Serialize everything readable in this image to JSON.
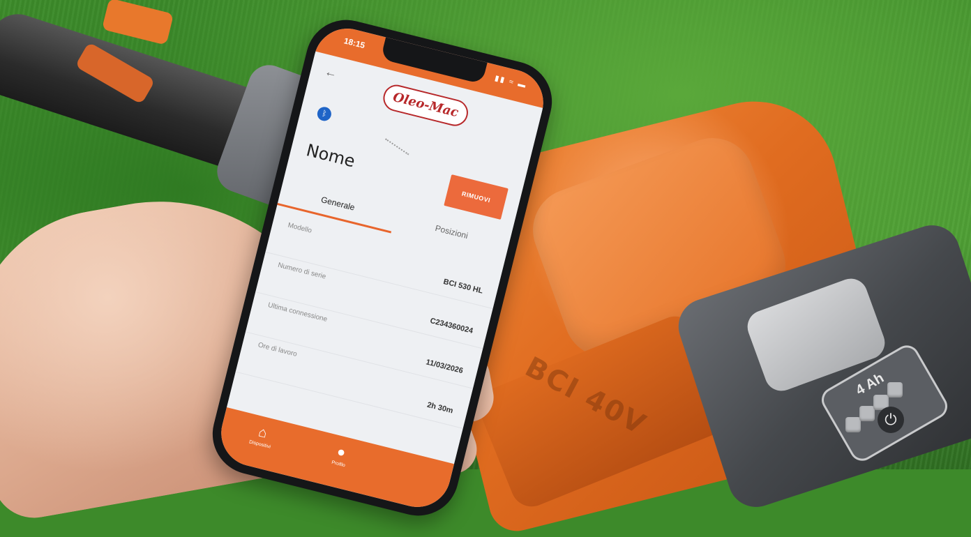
{
  "app": {
    "status_time": "18:15",
    "status_icons": "▮▮ ≈ ▬",
    "back_icon": "arrow-left-icon",
    "logo_text": "Oleo-Mac",
    "bluetooth_icon": "bluetooth-icon",
    "device_name": "Nome",
    "remove_button": "RIMUOVI",
    "tabs": [
      {
        "label": "Generale",
        "active": true
      },
      {
        "label": "Posizioni",
        "active": false
      }
    ],
    "info_rows": [
      {
        "label": "Modello",
        "value": "BCI 530 HL"
      },
      {
        "label": "Numero di serie",
        "value": "C234360024"
      },
      {
        "label": "Ultima connessione",
        "value": "11/03/2026"
      },
      {
        "label": "Ore di lavoro",
        "value": "2h 30m"
      }
    ],
    "bottom_nav": [
      {
        "icon": "home-icon",
        "label": "Dispositivi"
      },
      {
        "icon": "user-icon",
        "label": "Profilo"
      }
    ]
  },
  "scene": {
    "mower_model_text": "BCI",
    "mower_voltage_text": "40V",
    "battery_capacity": "4 Ah",
    "colors": {
      "brand_orange": "#e86c2c",
      "logo_red": "#b7282a",
      "grass": "#3f8f2c"
    }
  }
}
